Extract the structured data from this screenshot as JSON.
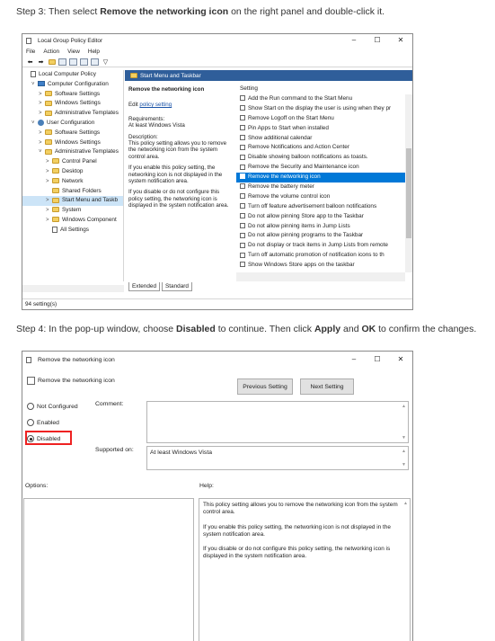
{
  "step3": {
    "prefix": "Step 3: Then select ",
    "bold": "Remove the networking icon",
    "suffix": " on the right panel and double-click it."
  },
  "gpe": {
    "title": "Local Group Policy Editor",
    "controls": [
      "–",
      "☐",
      "✕"
    ],
    "menu": [
      "File",
      "Action",
      "View",
      "Help"
    ],
    "tree": [
      {
        "label": "Local Computer Policy",
        "indent": 0,
        "arrow": "",
        "icon": "page"
      },
      {
        "label": "Computer Configuration",
        "indent": 1,
        "arrow": "⌄",
        "icon": "pc"
      },
      {
        "label": "Software Settings",
        "indent": 2,
        "arrow": ">",
        "icon": "folder"
      },
      {
        "label": "Windows Settings",
        "indent": 2,
        "arrow": ">",
        "icon": "folder"
      },
      {
        "label": "Administrative Templates",
        "indent": 2,
        "arrow": ">",
        "icon": "folder"
      },
      {
        "label": "User Configuration",
        "indent": 1,
        "arrow": "⌄",
        "icon": "user"
      },
      {
        "label": "Software Settings",
        "indent": 2,
        "arrow": ">",
        "icon": "folder"
      },
      {
        "label": "Windows Settings",
        "indent": 2,
        "arrow": ">",
        "icon": "folder"
      },
      {
        "label": "Administrative Templates",
        "indent": 2,
        "arrow": "⌄",
        "icon": "folder"
      },
      {
        "label": "Control Panel",
        "indent": 3,
        "arrow": ">",
        "icon": "folder"
      },
      {
        "label": "Desktop",
        "indent": 3,
        "arrow": ">",
        "icon": "folder"
      },
      {
        "label": "Network",
        "indent": 3,
        "arrow": ">",
        "icon": "folder"
      },
      {
        "label": "Shared Folders",
        "indent": 3,
        "arrow": "",
        "icon": "folder"
      },
      {
        "label": "Start Menu and Taskb",
        "indent": 3,
        "arrow": ">",
        "icon": "folder",
        "selected": true
      },
      {
        "label": "System",
        "indent": 3,
        "arrow": ">",
        "icon": "folder"
      },
      {
        "label": "Windows Component",
        "indent": 3,
        "arrow": ">",
        "icon": "folder"
      },
      {
        "label": "All Settings",
        "indent": 3,
        "arrow": "",
        "icon": "page"
      }
    ],
    "panel_header": "Start Menu and Taskbar",
    "desc_title": "Remove the networking icon",
    "edit_prefix": "Edit ",
    "edit_link": "policy setting",
    "requirements_label": "Requirements:",
    "requirements_value": "At least Windows Vista",
    "description_label": "Description:",
    "description": "This policy setting allows you to remove the networking icon from the system control area.",
    "desc_p2": "If you enable this policy setting, the networking icon is not displayed in the system notification area.",
    "desc_p3": "If you disable or do not configure this policy setting, the networking icon is displayed in the system notification area.",
    "settings_header": "Setting",
    "settings": [
      "Add the Run command to the Start Menu",
      "Show Start on the display the user is using when they pr",
      "Remove Logoff on the Start Menu",
      "Pin Apps to Start when installed",
      "Show additional calendar",
      "Remove Notifications and Action Center",
      "Disable showing balloon notifications as toasts.",
      "Remove the Security and Maintenance icon",
      "Remove the networking icon",
      "Remove the battery meter",
      "Remove the volume control icon",
      "Turn off feature advertisement balloon notifications",
      "Do not allow pinning Store app to the Taskbar",
      "Do not allow pinning items in Jump Lists",
      "Do not allow pinning programs to the Taskbar",
      "Do not display or track items in Jump Lists from remote",
      "Turn off automatic promotion of notification icons to th",
      "Show Windows Store apps on the taskbar"
    ],
    "highlighted_index": 8,
    "tabs": [
      "Extended",
      "Standard"
    ],
    "status": "94 setting(s)"
  },
  "step4": {
    "p1": "Step 4: In the pop-up window, choose ",
    "b1": "Disabled",
    "p2": " to continue. Then click ",
    "b2": "Apply",
    "p3": " and ",
    "b3": "OK",
    "p4": " to confirm the changes."
  },
  "dlg": {
    "title": "Remove the networking icon",
    "subtitle": "Remove the networking icon",
    "prev_button": "Previous Setting",
    "next_button": "Next Setting",
    "radio_not_configured": "Not Configured",
    "radio_enabled": "Enabled",
    "radio_disabled": "Disabled",
    "selected": "Disabled",
    "comment_label": "Comment:",
    "supported_label": "Supported on:",
    "supported_value": "At least Windows Vista",
    "options_label": "Options:",
    "help_label": "Help:",
    "help_p1": "This policy setting allows you to remove the networking icon from the system control area.",
    "help_p2": "If you enable this policy setting, the networking icon is not displayed in the system notification area.",
    "help_p3": "If you disable or do not configure this policy setting, the networking icon is displayed in the system notification area."
  }
}
